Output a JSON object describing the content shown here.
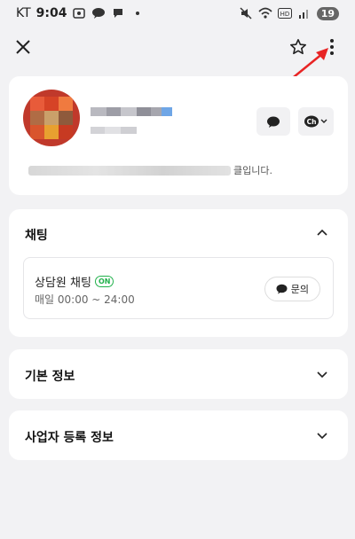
{
  "status_bar": {
    "carrier": "KT",
    "time": "9:04",
    "battery": "19"
  },
  "profile": {
    "description_suffix": "클입니다."
  },
  "chat_section": {
    "title": "채팅",
    "channel_name": "상담원 채팅",
    "status_badge": "ON",
    "hours": "매일 00:00 ~ 24:00",
    "inquire_label": "문의"
  },
  "basic_info": {
    "title": "기본 정보"
  },
  "business_info": {
    "title": "사업자 등록 정보"
  },
  "colors": {
    "background": "#f2f2f4",
    "card": "#ffffff",
    "on_badge": "#22b14c",
    "annotation_arrow": "#e82424"
  }
}
